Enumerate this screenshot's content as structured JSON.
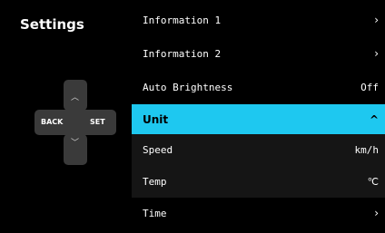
{
  "screen": {
    "title": "Settings"
  },
  "controls": {
    "back_label": "BACK",
    "set_label": "SET"
  },
  "menu": {
    "items": [
      {
        "label": "Information 1",
        "value": "›"
      },
      {
        "label": "Information 2",
        "value": "›"
      },
      {
        "label": "Auto Brightness",
        "value": "Off"
      },
      {
        "label": "Unit",
        "value": "^"
      },
      {
        "label": "Speed",
        "value": "km/h"
      },
      {
        "label": "Temp",
        "value": "℃"
      },
      {
        "label": "Time",
        "value": "›"
      }
    ]
  },
  "colors": {
    "accent": "#1ec8f0",
    "background": "#000000",
    "submenu": "#151515",
    "pad": "#3a3a3a"
  }
}
